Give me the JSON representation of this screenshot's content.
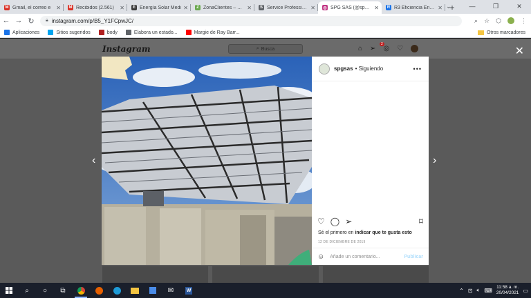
{
  "browser": {
    "tabs": [
      {
        "title": "Gmail, el correo e",
        "favicon": "gmail-icon",
        "color": "#d93025",
        "glyph": "M"
      },
      {
        "title": "Recibidos (2.561)",
        "favicon": "gmail-icon",
        "color": "#d93025",
        "glyph": "M"
      },
      {
        "title": "Energía Solar Medi",
        "favicon": "site-icon",
        "color": "#3a3a3a",
        "glyph": "E"
      },
      {
        "title": "ZonaClientes – Gru",
        "favicon": "leaf-icon",
        "color": "#6aa84f",
        "glyph": "Z"
      },
      {
        "title": "Service Professiona",
        "favicon": "globe-icon",
        "color": "#5f6368",
        "glyph": "S"
      },
      {
        "title": "SPG SAS (@spgsas)",
        "favicon": "instagram-icon",
        "color": "#c13584",
        "glyph": "◎",
        "active": true
      },
      {
        "title": "R3 Eficiencia Energ",
        "favicon": "r3-icon",
        "color": "#1a73e8",
        "glyph": "R"
      }
    ],
    "url": "instagram.com/p/B5_Y1FCpwJC/",
    "bookmarks": [
      {
        "label": "Aplicaciones",
        "color": "#1a73e8"
      },
      {
        "label": "Sitios sugeridos",
        "color": "#00a4ef"
      },
      {
        "label": "body",
        "color": "#b02020"
      },
      {
        "label": "Elabora un estado...",
        "color": "#5f6368"
      },
      {
        "label": "Margie de Ray Barr...",
        "color": "#ff0000"
      }
    ],
    "other_bookmarks": "Otros marcadores"
  },
  "instagram": {
    "logo": "Instagram",
    "search_placeholder": "Busca",
    "notification_count": "2",
    "post": {
      "username": "spgsas",
      "follow_status": "• Siguiendo",
      "likes_prefix": "Sé el primero en ",
      "likes_link": "indicar que te gusta esto",
      "date": "12 DE DICIEMBRE DE 2019",
      "comment_placeholder": "Añade un comentario...",
      "publish": "Publicar"
    }
  },
  "taskbar": {
    "time": "11:58 a. m.",
    "date": "20/04/2021"
  }
}
